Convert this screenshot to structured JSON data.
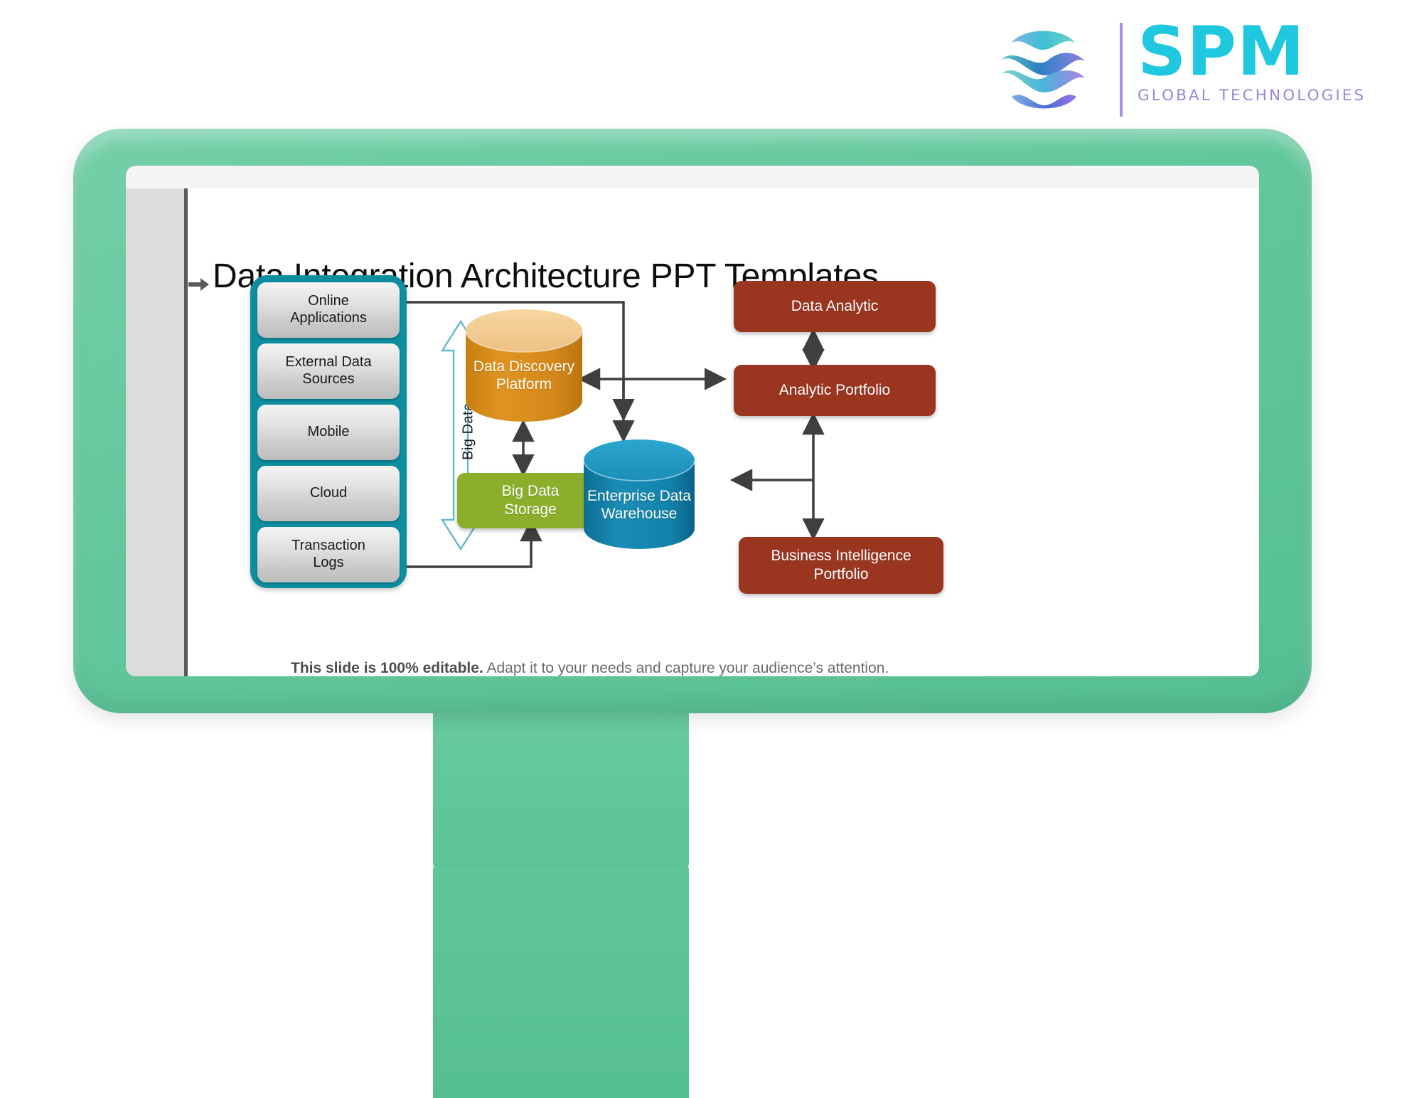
{
  "brand": {
    "name": "SPM",
    "tagline": "GLOBAL TECHNOLOGIES",
    "logo_icon": "spm-sphere-logo-icon",
    "accent_cyan": "#1fc8de",
    "accent_purple": "#9b86d8"
  },
  "monitor": {
    "bezel_color": "#62c79c",
    "screen_color": "#ffffff"
  },
  "slide": {
    "title": "Data Integration Architecture PPT Templates",
    "title_bullet_icon": "arrow-right-icon",
    "caption_bold": "This slide is 100%  editable.",
    "caption_rest": " Adapt it to your needs and capture your audience’s attention."
  },
  "diagram": {
    "sources_container_color": "#0c8e9f",
    "sources": [
      {
        "label": "Online\nApplications",
        "line1": "Online",
        "line2": "Applications"
      },
      {
        "label": "External Data Sources",
        "line1": "External Data",
        "line2": "Sources"
      },
      {
        "label": "Mobile",
        "line1": "Mobile",
        "line2": ""
      },
      {
        "label": "Cloud",
        "line1": "Cloud",
        "line2": ""
      },
      {
        "label": "Transaction Logs",
        "line1": "Transaction",
        "line2": "Logs"
      }
    ],
    "big_data_label": "Big Data",
    "big_data_arrow_icon": "double-headed-vertical-arrow-icon",
    "nodes": {
      "data_discovery": {
        "line1": "Data Discovery",
        "line2": "Platform",
        "shape": "cylinder",
        "color": "#d4881b"
      },
      "big_data_storage": {
        "line1": "Big Data",
        "line2": "Storage",
        "shape": "rounded-rect",
        "color": "#8caf2b"
      },
      "enterprise_data_warehouse": {
        "line1": "Enterprise Data",
        "line2": "Warehouse",
        "shape": "cylinder",
        "color": "#1282ab"
      },
      "data_analytic": {
        "line1": "Data Analytic",
        "line2": "",
        "shape": "rounded-rect",
        "color": "#9a3520"
      },
      "analytic_portfolio": {
        "line1": "Analytic Portfolio",
        "line2": "",
        "shape": "rounded-rect",
        "color": "#9a3520"
      },
      "business_intelligence_portfolio": {
        "line1": "Business Intelligence",
        "line2": "Portfolio",
        "shape": "rounded-rect",
        "color": "#9a3520"
      }
    },
    "connector_color": "#3f3f3f"
  }
}
